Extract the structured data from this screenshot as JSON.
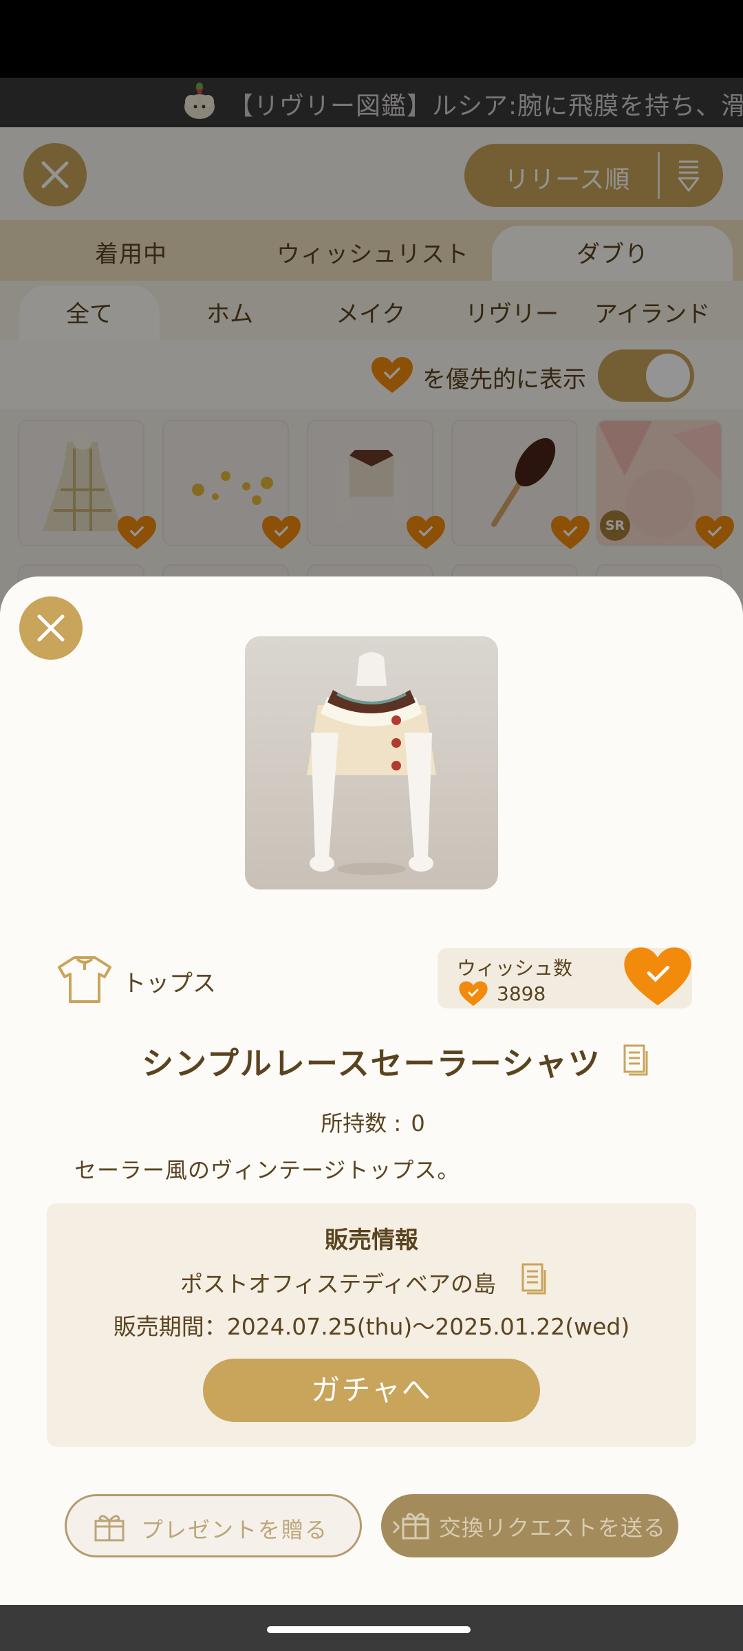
{
  "ticker": {
    "text": "【リヴリー図鑑】ルシア:腕に飛膜を持ち、滑空し"
  },
  "header": {
    "close_icon": "close-icon",
    "sort_label": "リリース順",
    "sort_icon": "sort-icon"
  },
  "tabs_primary": [
    {
      "label": "着用中"
    },
    {
      "label": "ウィッシュリスト"
    },
    {
      "label": "ダブり",
      "active": true
    }
  ],
  "tabs_secondary": [
    {
      "label": "全て",
      "active": true
    },
    {
      "label": "ホム"
    },
    {
      "label": "メイク"
    },
    {
      "label": "リヴリー"
    },
    {
      "label": "アイランド"
    }
  ],
  "priority_toggle": {
    "label": "を優先的に表示",
    "on": true
  },
  "grid": {
    "items": [
      "plaid-dress",
      "flower-sprinkles",
      "sailor-shirt",
      "chocolate-spoon",
      "sr-item"
    ],
    "sr_badge": "SR"
  },
  "detail": {
    "category_label": "トップス",
    "wish_title": "ウィッシュ数",
    "wish_count": "3898",
    "name": "シンプルレースセーラーシャツ",
    "owned_label": "所持数 : ",
    "owned_value": "0",
    "description": "セーラー風のヴィンテージトップス。",
    "sale": {
      "title": "販売情報",
      "place": "ポストオフィステディベアの島",
      "period": "販売期間：2024.07.25(thu)〜2025.01.22(wed)",
      "gacha_button": "ガチャへ"
    },
    "present_button": "プレゼントを贈る",
    "exchange_button": "交換リクエストを送る"
  },
  "colors": {
    "accent": "#c9a45b",
    "heart": "#f28a0c",
    "text": "#5a4420"
  }
}
